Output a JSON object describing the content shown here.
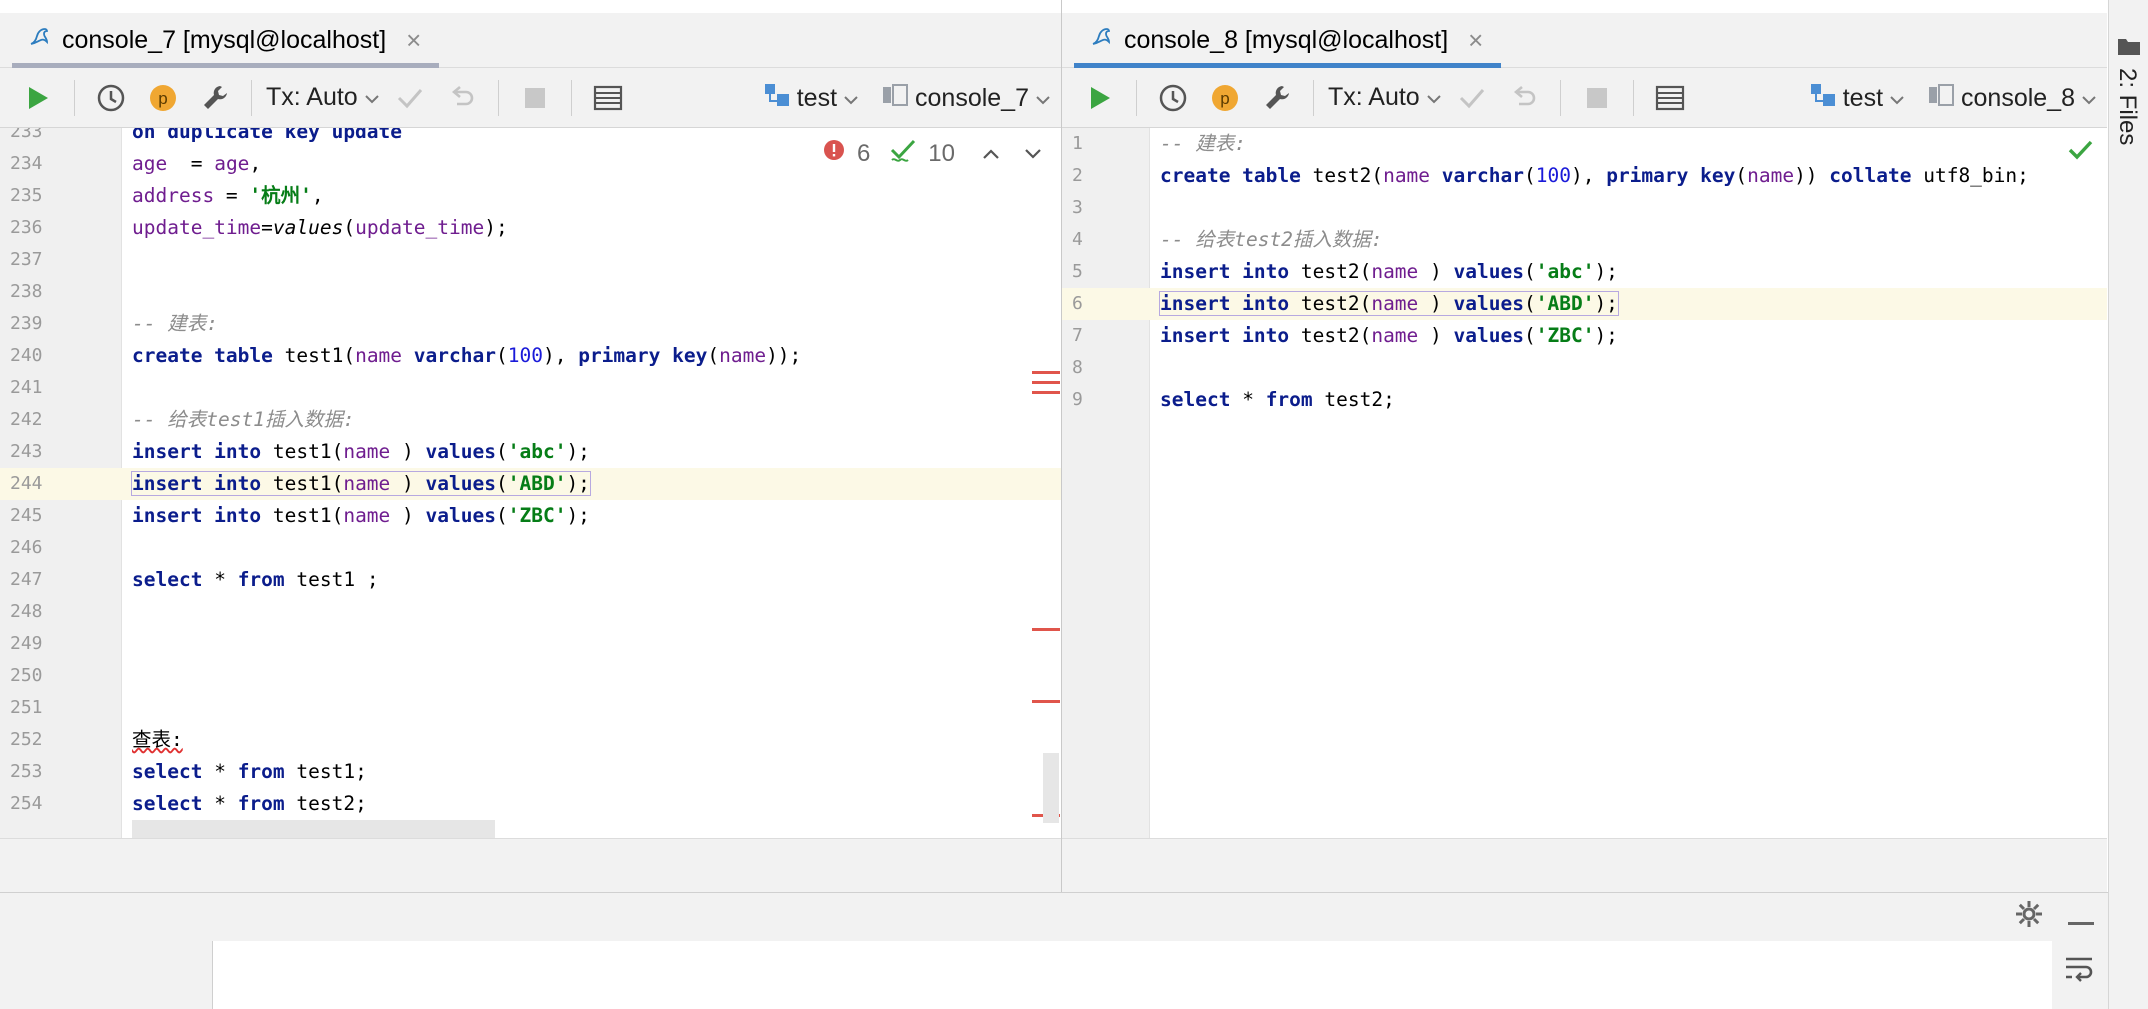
{
  "left": {
    "tab": {
      "title": "console_7 [mysql@localhost]",
      "close": "×"
    },
    "toolbar": {
      "tx": "Tx: Auto",
      "schema": "test",
      "console": "console_7",
      "p_badge": "p"
    },
    "inspect": {
      "errors": "6",
      "checks": "10"
    },
    "lines": [
      {
        "n": "233",
        "tokens": [
          [
            "kw",
            "on duplicate key update"
          ]
        ]
      },
      {
        "n": "234",
        "tokens": [
          [
            "fn",
            "age"
          ],
          [
            "",
            "  = "
          ],
          [
            "fn",
            "age"
          ],
          [
            "",
            ","
          ]
        ]
      },
      {
        "n": "235",
        "tokens": [
          [
            "fn",
            "address"
          ],
          [
            "",
            " = "
          ],
          [
            "str",
            "'杭州'"
          ],
          [
            "",
            ","
          ]
        ]
      },
      {
        "n": "236",
        "tokens": [
          [
            "fn",
            "update_time"
          ],
          [
            "",
            "="
          ],
          [
            "it",
            "values"
          ],
          [
            "",
            "("
          ],
          [
            "fn",
            "update_time"
          ],
          [
            "",
            ");"
          ]
        ]
      },
      {
        "n": "237",
        "tokens": []
      },
      {
        "n": "238",
        "tokens": []
      },
      {
        "n": "239",
        "tokens": [
          [
            "cm",
            "-- 建表:"
          ]
        ]
      },
      {
        "n": "240",
        "tokens": [
          [
            "kw",
            "create table"
          ],
          [
            "",
            " test1("
          ],
          [
            "fn",
            "name"
          ],
          [
            "",
            " "
          ],
          [
            "kw",
            "varchar"
          ],
          [
            "",
            "("
          ],
          [
            "num",
            "100"
          ],
          [
            "",
            "), "
          ],
          [
            "kw",
            "primary key"
          ],
          [
            "",
            "("
          ],
          [
            "fn",
            "name"
          ],
          [
            "",
            "));"
          ]
        ]
      },
      {
        "n": "241",
        "tokens": []
      },
      {
        "n": "242",
        "tokens": [
          [
            "cm",
            "-- 给表test1插入数据:"
          ]
        ]
      },
      {
        "n": "243",
        "tokens": [
          [
            "kw",
            "insert into"
          ],
          [
            "",
            " test1("
          ],
          [
            "fn",
            "name"
          ],
          [
            "",
            " ) "
          ],
          [
            "kw",
            "values"
          ],
          [
            "",
            "("
          ],
          [
            "str",
            "'abc'"
          ],
          [
            "",
            ");"
          ]
        ]
      },
      {
        "n": "244",
        "tokens": [
          [
            "kw",
            "insert into"
          ],
          [
            "",
            " test1("
          ],
          [
            "fn",
            "name"
          ],
          [
            "",
            " ) "
          ],
          [
            "kw",
            "values"
          ],
          [
            "",
            "("
          ],
          [
            "str",
            "'ABD'"
          ],
          [
            "",
            ");"
          ]
        ],
        "hl": true
      },
      {
        "n": "245",
        "tokens": [
          [
            "kw",
            "insert into"
          ],
          [
            "",
            " test1("
          ],
          [
            "fn",
            "name"
          ],
          [
            "",
            " ) "
          ],
          [
            "kw",
            "values"
          ],
          [
            "",
            "("
          ],
          [
            "str",
            "'ZBC'"
          ],
          [
            "",
            ");"
          ]
        ]
      },
      {
        "n": "246",
        "tokens": []
      },
      {
        "n": "247",
        "tokens": [
          [
            "kw",
            "select"
          ],
          [
            "",
            " * "
          ],
          [
            "kw",
            "from"
          ],
          [
            "",
            " test1 ;"
          ]
        ]
      },
      {
        "n": "248",
        "tokens": []
      },
      {
        "n": "249",
        "tokens": []
      },
      {
        "n": "250",
        "tokens": []
      },
      {
        "n": "251",
        "tokens": []
      },
      {
        "n": "252",
        "tokens": [
          [
            "sq",
            "查表:"
          ]
        ]
      },
      {
        "n": "253",
        "tokens": [
          [
            "kw",
            "select"
          ],
          [
            "",
            " * "
          ],
          [
            "kw",
            "from"
          ],
          [
            "",
            " test1;"
          ]
        ]
      },
      {
        "n": "254",
        "tokens": [
          [
            "kw",
            "select"
          ],
          [
            "",
            " * "
          ],
          [
            "kw",
            "from"
          ],
          [
            "",
            " test2;"
          ]
        ]
      }
    ]
  },
  "right": {
    "tab": {
      "title": "console_8 [mysql@localhost]",
      "close": "×"
    },
    "toolbar": {
      "tx": "Tx: Auto",
      "schema": "test",
      "console": "console_8",
      "p_badge": "p"
    },
    "lines": [
      {
        "n": "1",
        "tokens": [
          [
            "cm",
            "-- 建表:"
          ]
        ]
      },
      {
        "n": "2",
        "tokens": [
          [
            "kw",
            "create table"
          ],
          [
            "",
            " test2("
          ],
          [
            "fn",
            "name"
          ],
          [
            "",
            " "
          ],
          [
            "kw",
            "varchar"
          ],
          [
            "",
            "("
          ],
          [
            "num",
            "100"
          ],
          [
            "",
            "), "
          ],
          [
            "kw",
            "primary key"
          ],
          [
            "",
            "("
          ],
          [
            "fn",
            "name"
          ],
          [
            "",
            ")) "
          ],
          [
            "kw",
            "collate"
          ],
          [
            "",
            " utf8_bin;"
          ]
        ]
      },
      {
        "n": "3",
        "tokens": []
      },
      {
        "n": "4",
        "tokens": [
          [
            "cm",
            "-- 给表test2插入数据:"
          ]
        ]
      },
      {
        "n": "5",
        "tokens": [
          [
            "kw",
            "insert into"
          ],
          [
            "",
            " test2("
          ],
          [
            "fn",
            "name"
          ],
          [
            "",
            " ) "
          ],
          [
            "kw",
            "values"
          ],
          [
            "",
            "("
          ],
          [
            "str",
            "'abc'"
          ],
          [
            "",
            ");"
          ]
        ]
      },
      {
        "n": "6",
        "tokens": [
          [
            "kw",
            "insert into"
          ],
          [
            "",
            " test2("
          ],
          [
            "fn",
            "name"
          ],
          [
            "",
            " ) "
          ],
          [
            "kw",
            "values"
          ],
          [
            "",
            "("
          ],
          [
            "str",
            "'ABD'"
          ],
          [
            "",
            ");"
          ]
        ],
        "hl": true
      },
      {
        "n": "7",
        "tokens": [
          [
            "kw",
            "insert into"
          ],
          [
            "",
            " test2("
          ],
          [
            "fn",
            "name"
          ],
          [
            "",
            " ) "
          ],
          [
            "kw",
            "values"
          ],
          [
            "",
            "("
          ],
          [
            "str",
            "'ZBC'"
          ],
          [
            "",
            ");"
          ]
        ]
      },
      {
        "n": "8",
        "tokens": []
      },
      {
        "n": "9",
        "tokens": [
          [
            "kw",
            "select"
          ],
          [
            "",
            " * "
          ],
          [
            "kw",
            "from"
          ],
          [
            "",
            " test2;"
          ]
        ]
      }
    ]
  },
  "sidebar": {
    "files_label": "2: Files"
  },
  "colors": {
    "run": "#3ba541",
    "badge": "#f0a732",
    "error": "#d9534f",
    "check": "#3ba541"
  }
}
